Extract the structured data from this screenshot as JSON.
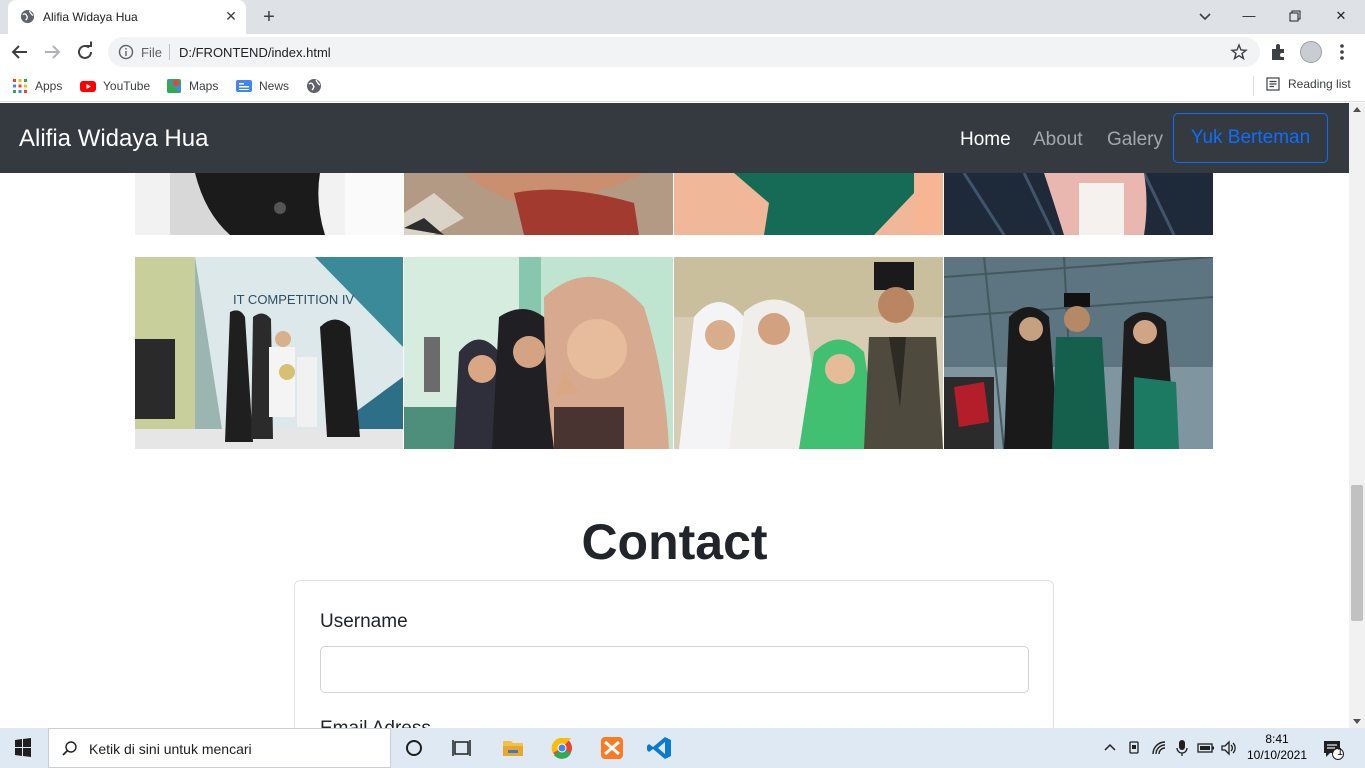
{
  "browser": {
    "tab_title": "Alifia Widaya Hua",
    "url_scheme_label": "File",
    "url": "D:/FRONTEND/index.html",
    "bookmarks": [
      {
        "label": "Apps",
        "icon": "apps-grid-icon"
      },
      {
        "label": "YouTube",
        "icon": "youtube-icon"
      },
      {
        "label": "Maps",
        "icon": "maps-icon"
      },
      {
        "label": "News",
        "icon": "news-icon"
      }
    ],
    "reading_list_label": "Reading list"
  },
  "navbar": {
    "brand": "Alifia Widaya Hua",
    "links": [
      {
        "label": "Home",
        "active": true
      },
      {
        "label": "About",
        "active": false
      },
      {
        "label": "Galery",
        "active": false
      }
    ],
    "cta": "Yuk Berteman"
  },
  "contact": {
    "title": "Contact",
    "username_label": "Username",
    "email_label": "Email Adress"
  },
  "taskbar": {
    "search_placeholder": "Ketik di sini untuk mencari",
    "time": "8:41",
    "date": "10/10/2021",
    "notification_count": "1"
  },
  "colors": {
    "navbar_bg": "#343a40",
    "cta_blue": "#0d6efd",
    "chrome_frame": "#dee1e6",
    "taskbar_bg": "#dfe9f3"
  }
}
